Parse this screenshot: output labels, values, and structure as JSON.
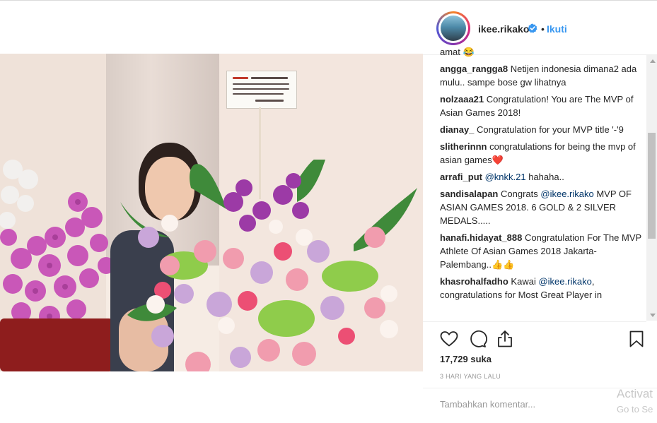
{
  "post": {
    "username": "ikee.rikako",
    "separator": "•",
    "follow_label": "Ikuti",
    "likes": "17,729 suka",
    "time": "3 HARI YANG LALU",
    "comment_placeholder": "Tambahkan komentar..."
  },
  "comments": [
    {
      "user": "",
      "text": "amat 😂"
    },
    {
      "user": "angga_rangga8",
      "text": "Netijen indonesia dimana2 ada mulu.. sampe bose gw lihatnya"
    },
    {
      "user": "nolzaaa21",
      "text": "Congratulation! You are The MVP of Asian Games 2018!"
    },
    {
      "user": "dianay_",
      "text": "Congratulation for your MVP title '-'9"
    },
    {
      "user": "slitherinnn",
      "text": "congratulations for being the mvp of asian games",
      "emoji": "❤️"
    },
    {
      "user": "arrafi_put",
      "mention": "@knkk.21",
      "text": "hahaha.."
    },
    {
      "user": "sandisalapan",
      "text_before": "Congrats",
      "mention": "@ikee.rikako",
      "text": "MVP OF ASIAN GAMES 2018. 6 GOLD & 2 SILVER MEDALS....."
    },
    {
      "user": "hanafi.hidayat_888",
      "text": "Congratulation For The MVP Athlete Of Asian Games 2018 Jakarta-Palembang..",
      "emoji": "👍👍"
    },
    {
      "user": "khasrohalfadho",
      "text_before": "Kawai",
      "mention": "@ikee.rikako",
      "text": ", congratulations for Most Great Player in"
    }
  ],
  "overlay": {
    "line1": "Activat",
    "line2": "Go to Se"
  },
  "icons": [
    "heart-icon",
    "comment-icon",
    "share-icon",
    "bookmark-icon",
    "verified-badge-icon"
  ],
  "colors": {
    "link": "#3897f0",
    "verified": "#3897f0",
    "text": "#262626",
    "muted": "#999999"
  }
}
